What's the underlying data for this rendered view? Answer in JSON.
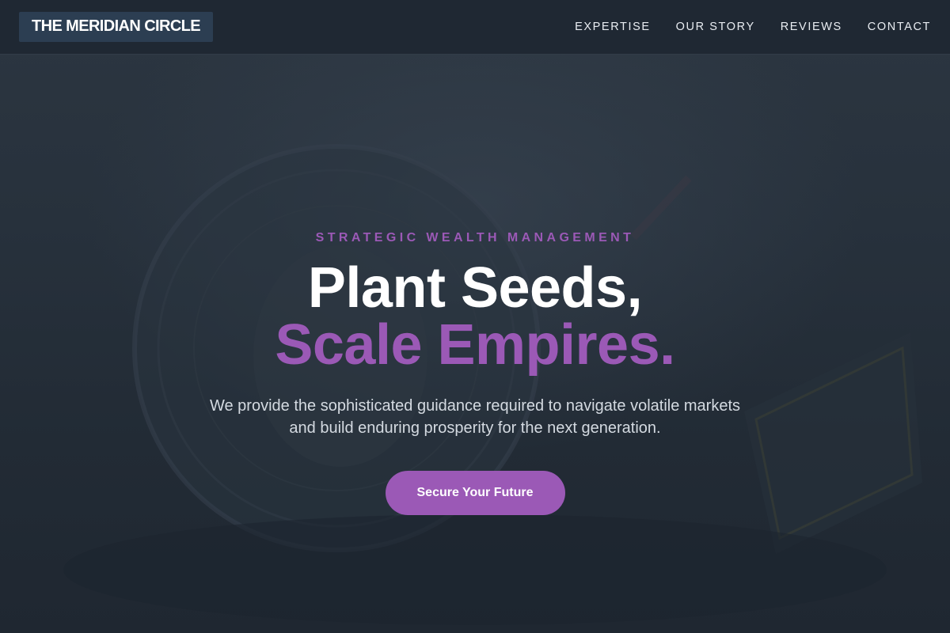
{
  "header": {
    "logo_text": "THE MERIDIAN CIRCLE",
    "nav": [
      {
        "label": "EXPERTISE"
      },
      {
        "label": "OUR STORY"
      },
      {
        "label": "REVIEWS"
      },
      {
        "label": "CONTACT"
      }
    ]
  },
  "hero": {
    "eyebrow": "STRATEGIC WEALTH MANAGEMENT",
    "headline_line1": "Plant Seeds,",
    "headline_line2": "Scale Empires.",
    "subtext": "We provide the sophisticated guidance required to navigate volatile markets and build enduring prosperity for the next generation.",
    "cta_label": "Secure Your Future",
    "background_image": "coin-and-banknote-photo"
  },
  "colors": {
    "accent": "#9b59b6",
    "header_bg": "#1f2833",
    "logo_bg": "#2c3e52",
    "page_bg": "#222b36"
  }
}
